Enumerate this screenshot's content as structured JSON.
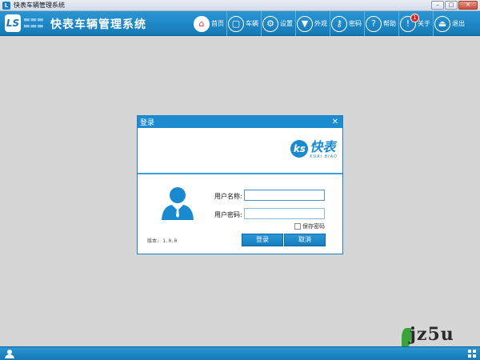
{
  "window": {
    "title": "快表车辆管理系统"
  },
  "header": {
    "logo_text": "LS",
    "app_title": "快表车辆管理系统",
    "nav": [
      {
        "label": "首页",
        "icon": "home-icon",
        "active": true
      },
      {
        "label": "车辆",
        "icon": "vehicle-icon"
      },
      {
        "label": "设置",
        "icon": "gear-icon"
      },
      {
        "label": "外观",
        "icon": "shirt-icon"
      },
      {
        "label": "密码",
        "icon": "key-icon"
      },
      {
        "label": "帮助",
        "icon": "help-icon"
      },
      {
        "label": "关于",
        "icon": "info-icon",
        "badge": "1"
      },
      {
        "label": "退出",
        "icon": "exit-icon"
      }
    ]
  },
  "login": {
    "title": "登录",
    "brand_name": "快表",
    "brand_sub": "KUAI BIAO",
    "username_label": "用户名称:",
    "username_value": "",
    "password_label": "用户密码:",
    "password_value": "",
    "remember_label": "保存密码",
    "remember_checked": false,
    "version": "版本: 1.0.0",
    "login_button": "登录",
    "cancel_button": "取消"
  },
  "watermark": "jz5u",
  "colors": {
    "primary": "#1d8bd0",
    "background": "#d6d6d6",
    "badge": "#e02020"
  }
}
